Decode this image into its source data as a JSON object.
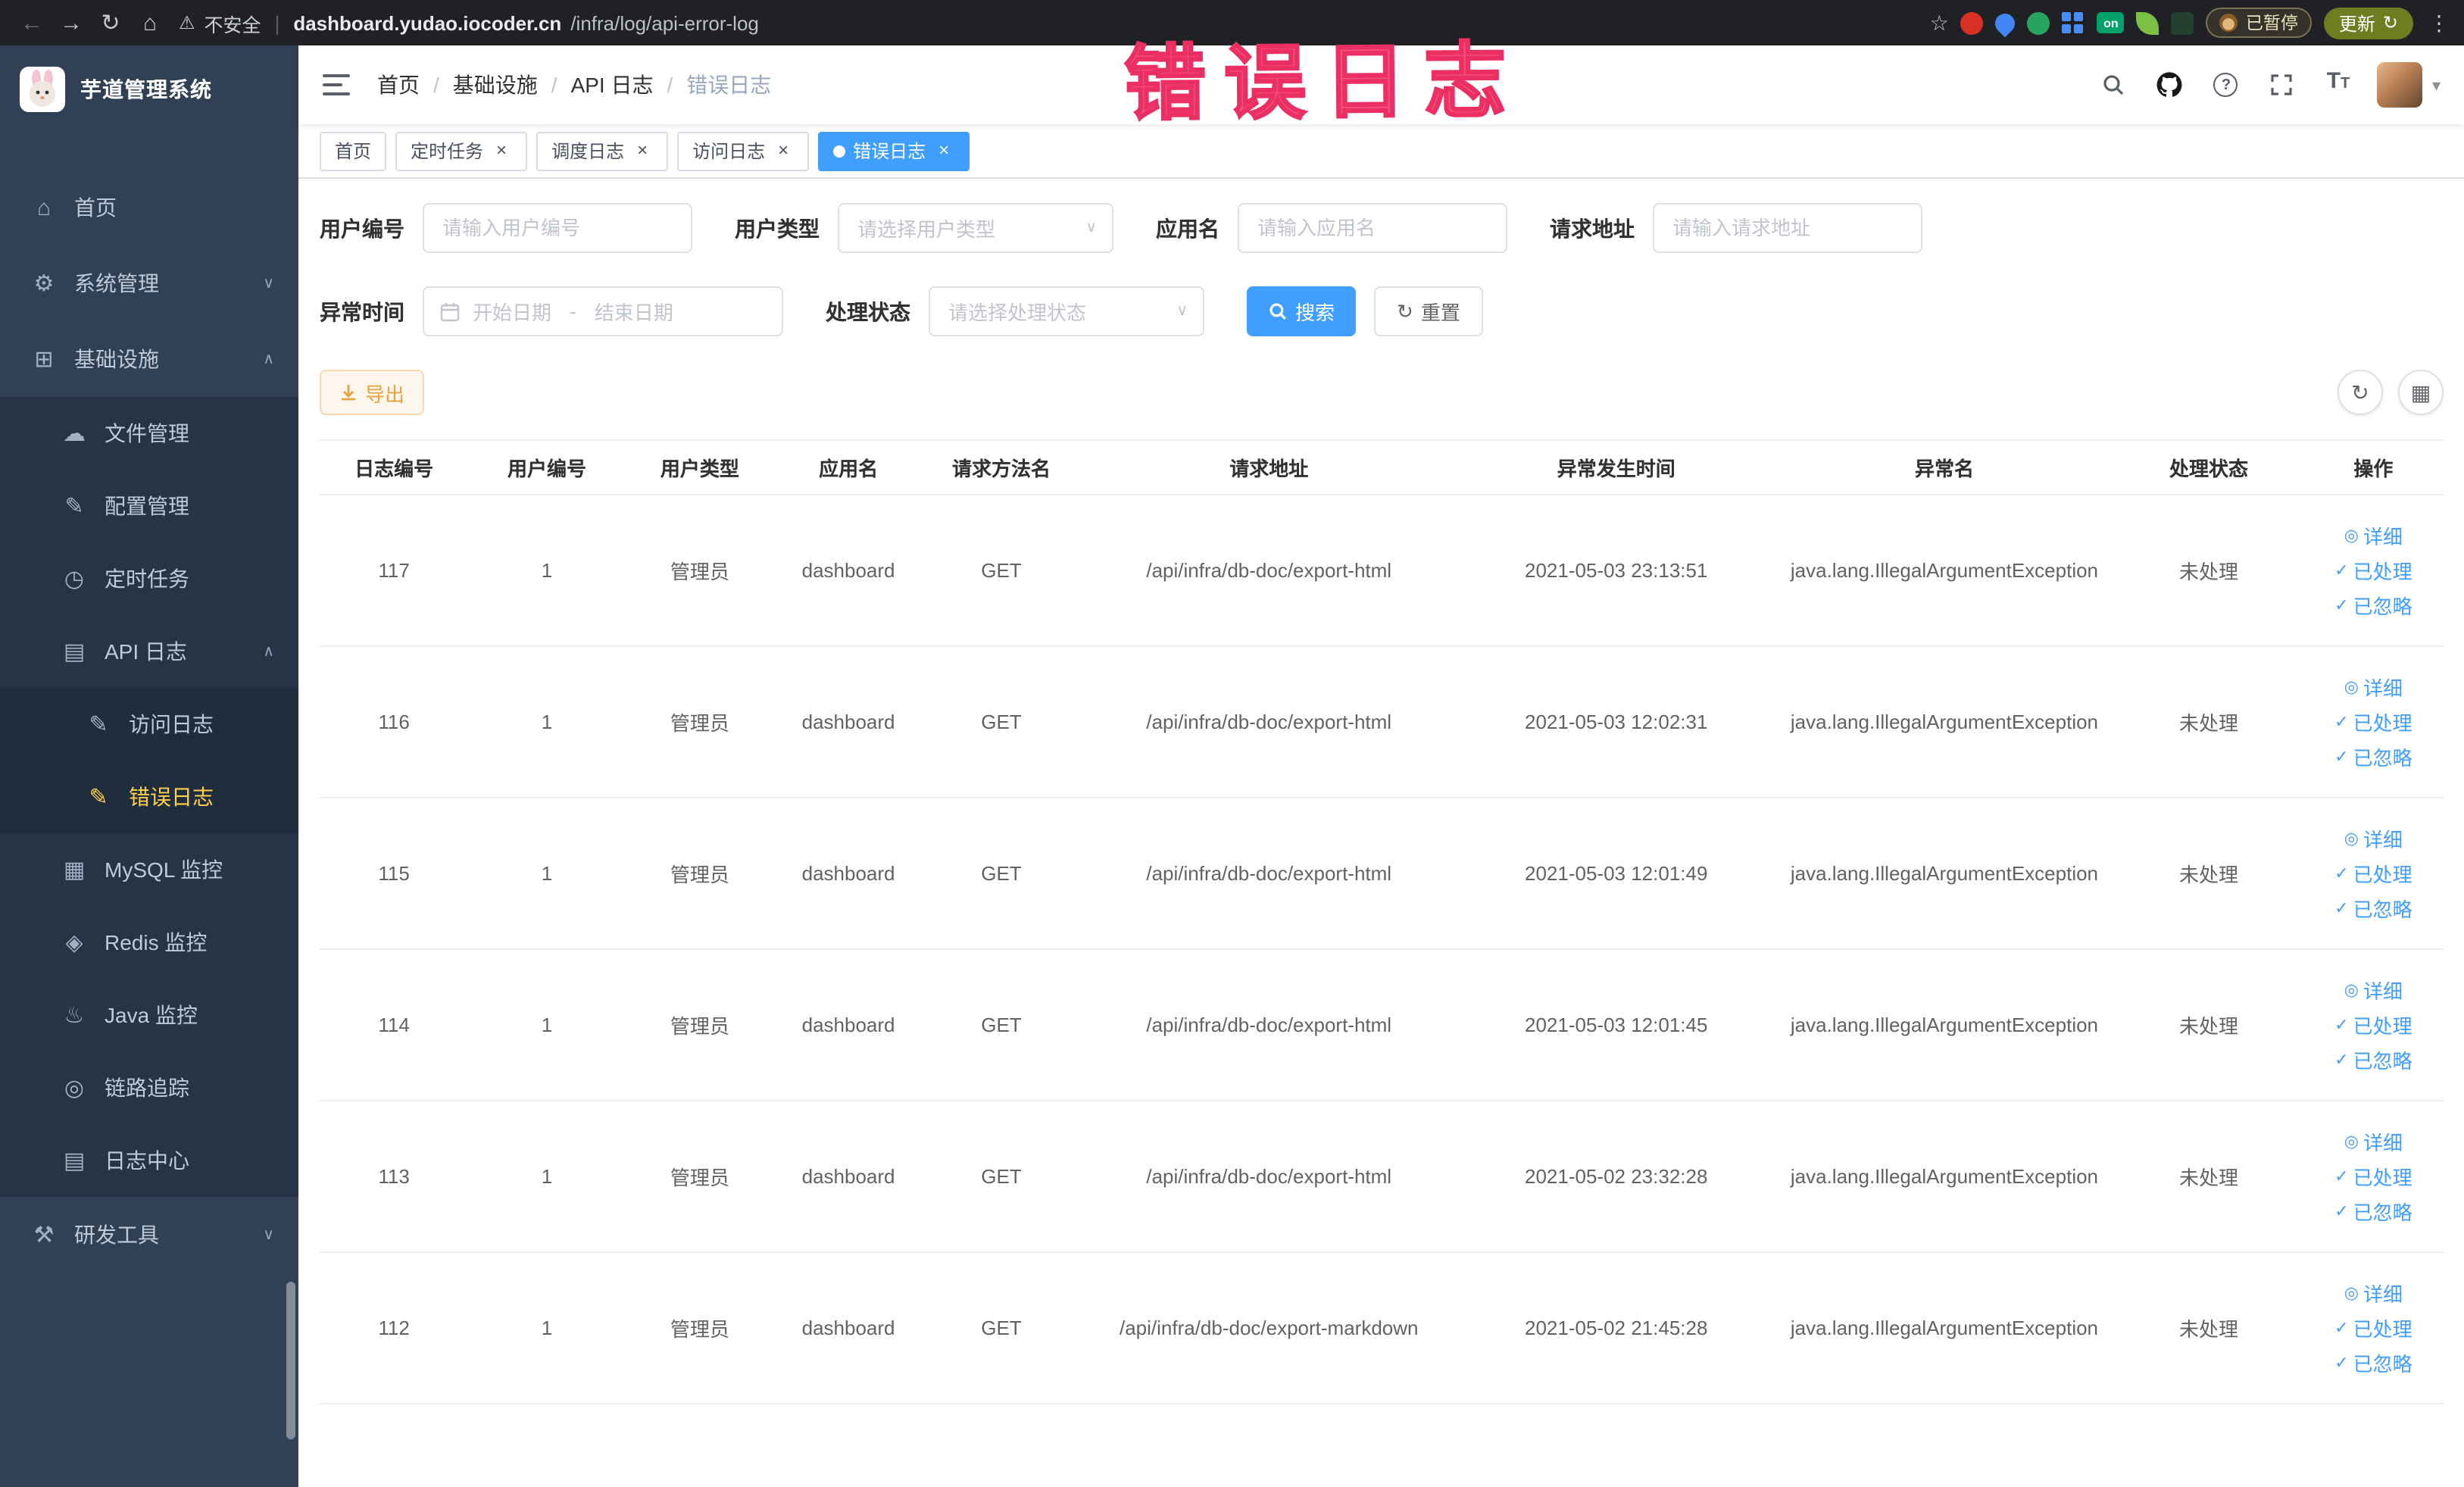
{
  "annotation": {
    "text": "错误日志"
  },
  "glyphs": {
    "back": "←",
    "forward": "→",
    "refresh": "↻",
    "home": "⌂",
    "warning": "⚠",
    "pipe": "|",
    "star": "☆",
    "more": "⋮",
    "caret_down": "▾",
    "chevron_down": "∨",
    "chevron_up": "∧",
    "check": "✓",
    "eye": "◎",
    "grid": "▦",
    "question": "?"
  },
  "browser": {
    "security_label": "不安全",
    "url_host": "dashboard.yudao.iocoder.cn",
    "url_path": "/infra/log/api-error-log",
    "extension_on_badge": "on",
    "paused_badge": "已暂停",
    "update_button": "更新"
  },
  "sidebar": {
    "app_title": "芋道管理系统",
    "items": [
      {
        "label": "首页",
        "icon": "⌂"
      },
      {
        "label": "系统管理",
        "icon": "⚙"
      },
      {
        "label": "基础设施",
        "icon": "⊞"
      },
      {
        "label": "文件管理",
        "icon": "☁"
      },
      {
        "label": "配置管理",
        "icon": "✎"
      },
      {
        "label": "定时任务",
        "icon": "◷"
      },
      {
        "label": "API 日志",
        "icon": "▤"
      },
      {
        "label": "访问日志",
        "icon": "✎"
      },
      {
        "label": "错误日志",
        "icon": "✎",
        "active": true
      },
      {
        "label": "MySQL 监控",
        "icon": "▦"
      },
      {
        "label": "Redis 监控",
        "icon": "◈"
      },
      {
        "label": "Java 监控",
        "icon": "♨"
      },
      {
        "label": "链路追踪",
        "icon": "◎"
      },
      {
        "label": "日志中心",
        "icon": "▤"
      },
      {
        "label": "研发工具",
        "icon": "⚒"
      }
    ]
  },
  "header": {
    "breadcrumb": [
      "首页",
      "基础设施",
      "API 日志",
      "错误日志"
    ],
    "separator": "/"
  },
  "tabs": {
    "close_glyph": "×",
    "items": [
      {
        "label": "首页"
      },
      {
        "label": "定时任务"
      },
      {
        "label": "调度日志"
      },
      {
        "label": "访问日志"
      },
      {
        "label": "错误日志"
      }
    ]
  },
  "filters": {
    "user_id": {
      "label": "用户编号",
      "placeholder": "请输入用户编号"
    },
    "user_type": {
      "label": "用户类型",
      "placeholder": "请选择用户类型"
    },
    "app_name": {
      "label": "应用名",
      "placeholder": "请输入应用名"
    },
    "request_url": {
      "label": "请求地址",
      "placeholder": "请输入请求地址"
    },
    "exception_time": {
      "label": "异常时间",
      "start_placeholder": "开始日期",
      "separator": "-",
      "end_placeholder": "结束日期"
    },
    "process_status": {
      "label": "处理状态",
      "placeholder": "请选择处理状态"
    },
    "search_button": "搜索",
    "reset_button": "重置"
  },
  "toolbar": {
    "export_button": "导出"
  },
  "table": {
    "columns": [
      "日志编号",
      "用户编号",
      "用户类型",
      "应用名",
      "请求方法名",
      "请求地址",
      "异常发生时间",
      "异常名",
      "处理状态",
      "操作"
    ],
    "action_labels": [
      "详细",
      "已处理",
      "已忽略"
    ],
    "rows": [
      {
        "id": "117",
        "user_id": "1",
        "user_type": "管理员",
        "app": "dashboard",
        "method": "GET",
        "url": "/api/infra/db-doc/export-html",
        "time": "2021-05-03 23:13:51",
        "exception": "java.lang.IllegalArgumentException",
        "status": "未处理"
      },
      {
        "id": "116",
        "user_id": "1",
        "user_type": "管理员",
        "app": "dashboard",
        "method": "GET",
        "url": "/api/infra/db-doc/export-html",
        "time": "2021-05-03 12:02:31",
        "exception": "java.lang.IllegalArgumentException",
        "status": "未处理"
      },
      {
        "id": "115",
        "user_id": "1",
        "user_type": "管理员",
        "app": "dashboard",
        "method": "GET",
        "url": "/api/infra/db-doc/export-html",
        "time": "2021-05-03 12:01:49",
        "exception": "java.lang.IllegalArgumentException",
        "status": "未处理"
      },
      {
        "id": "114",
        "user_id": "1",
        "user_type": "管理员",
        "app": "dashboard",
        "method": "GET",
        "url": "/api/infra/db-doc/export-html",
        "time": "2021-05-03 12:01:45",
        "exception": "java.lang.IllegalArgumentException",
        "status": "未处理"
      },
      {
        "id": "113",
        "user_id": "1",
        "user_type": "管理员",
        "app": "dashboard",
        "method": "GET",
        "url": "/api/infra/db-doc/export-html",
        "time": "2021-05-02 23:32:28",
        "exception": "java.lang.IllegalArgumentException",
        "status": "未处理"
      },
      {
        "id": "112",
        "user_id": "1",
        "user_type": "管理员",
        "app": "dashboard",
        "method": "GET",
        "url": "/api/infra/db-doc/export-markdown",
        "time": "2021-05-02 21:45:28",
        "exception": "java.lang.IllegalArgumentException",
        "status": "未处理"
      }
    ]
  }
}
